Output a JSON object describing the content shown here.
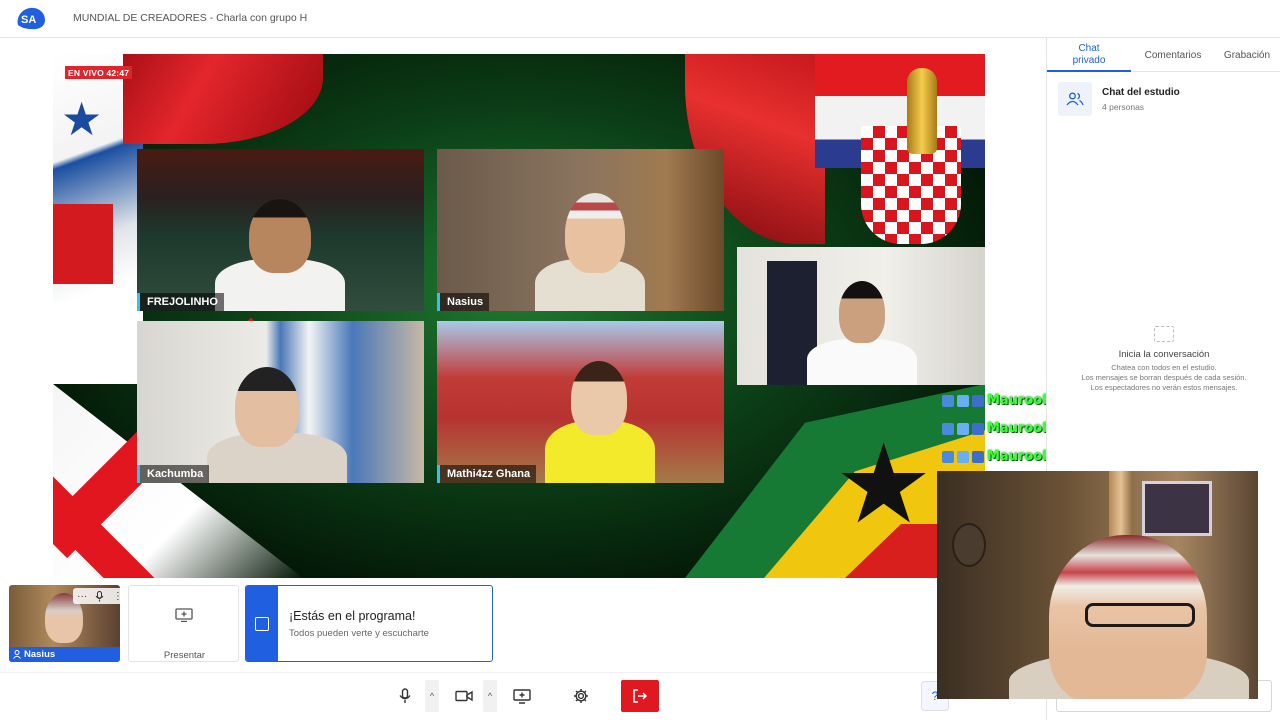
{
  "header": {
    "title": "MUNDIAL DE CREADORES - Charla con grupo H",
    "logo_icon": "streamyard-logo-icon"
  },
  "stage": {
    "live_badge": "EN VIVO 42:47",
    "participants": [
      {
        "name": "FREJOLINHO"
      },
      {
        "name": "Nasius"
      },
      {
        "name": "Kachumba"
      },
      {
        "name": "Mathi4zz Ghana"
      }
    ],
    "overlay_messages": [
      {
        "name": "MaurooFloress",
        "sep": ":"
      },
      {
        "name": "MaurooFloress",
        "sep": ":"
      },
      {
        "name": "MaurooFloress",
        "sep": ":"
      }
    ]
  },
  "self_tile": {
    "name": "Nasius",
    "controls": [
      "more-icon",
      "mic-icon",
      "kebab-icon"
    ]
  },
  "present_tile": {
    "label": "Presentar"
  },
  "on_air": {
    "title": "¡Estás en el programa!",
    "subtitle": "Todos pueden verte y escucharte"
  },
  "toolbar": {
    "buttons": [
      "mic-icon",
      "camera-icon",
      "share-screen-icon",
      "settings-icon",
      "leave-icon"
    ],
    "accent": "#e0181f"
  },
  "sidebar": {
    "tabs": [
      {
        "label": "Chat privado",
        "active": true
      },
      {
        "label": "Comentarios",
        "active": false
      },
      {
        "label": "Grabación",
        "active": false
      }
    ],
    "chat": {
      "title": "Chat del estudio",
      "count": "4 personas"
    },
    "empty": {
      "title": "Inicia la conversación",
      "line1": "Chatea con todos en el estudio.",
      "line2": "Los mensajes se borran después de cada sesión.",
      "line3": "Los espectadores no verán estos mensajes."
    }
  },
  "colors": {
    "brand": "#1f5fe0",
    "live": "#e0242b",
    "overlay_text": "#3cff3c"
  }
}
